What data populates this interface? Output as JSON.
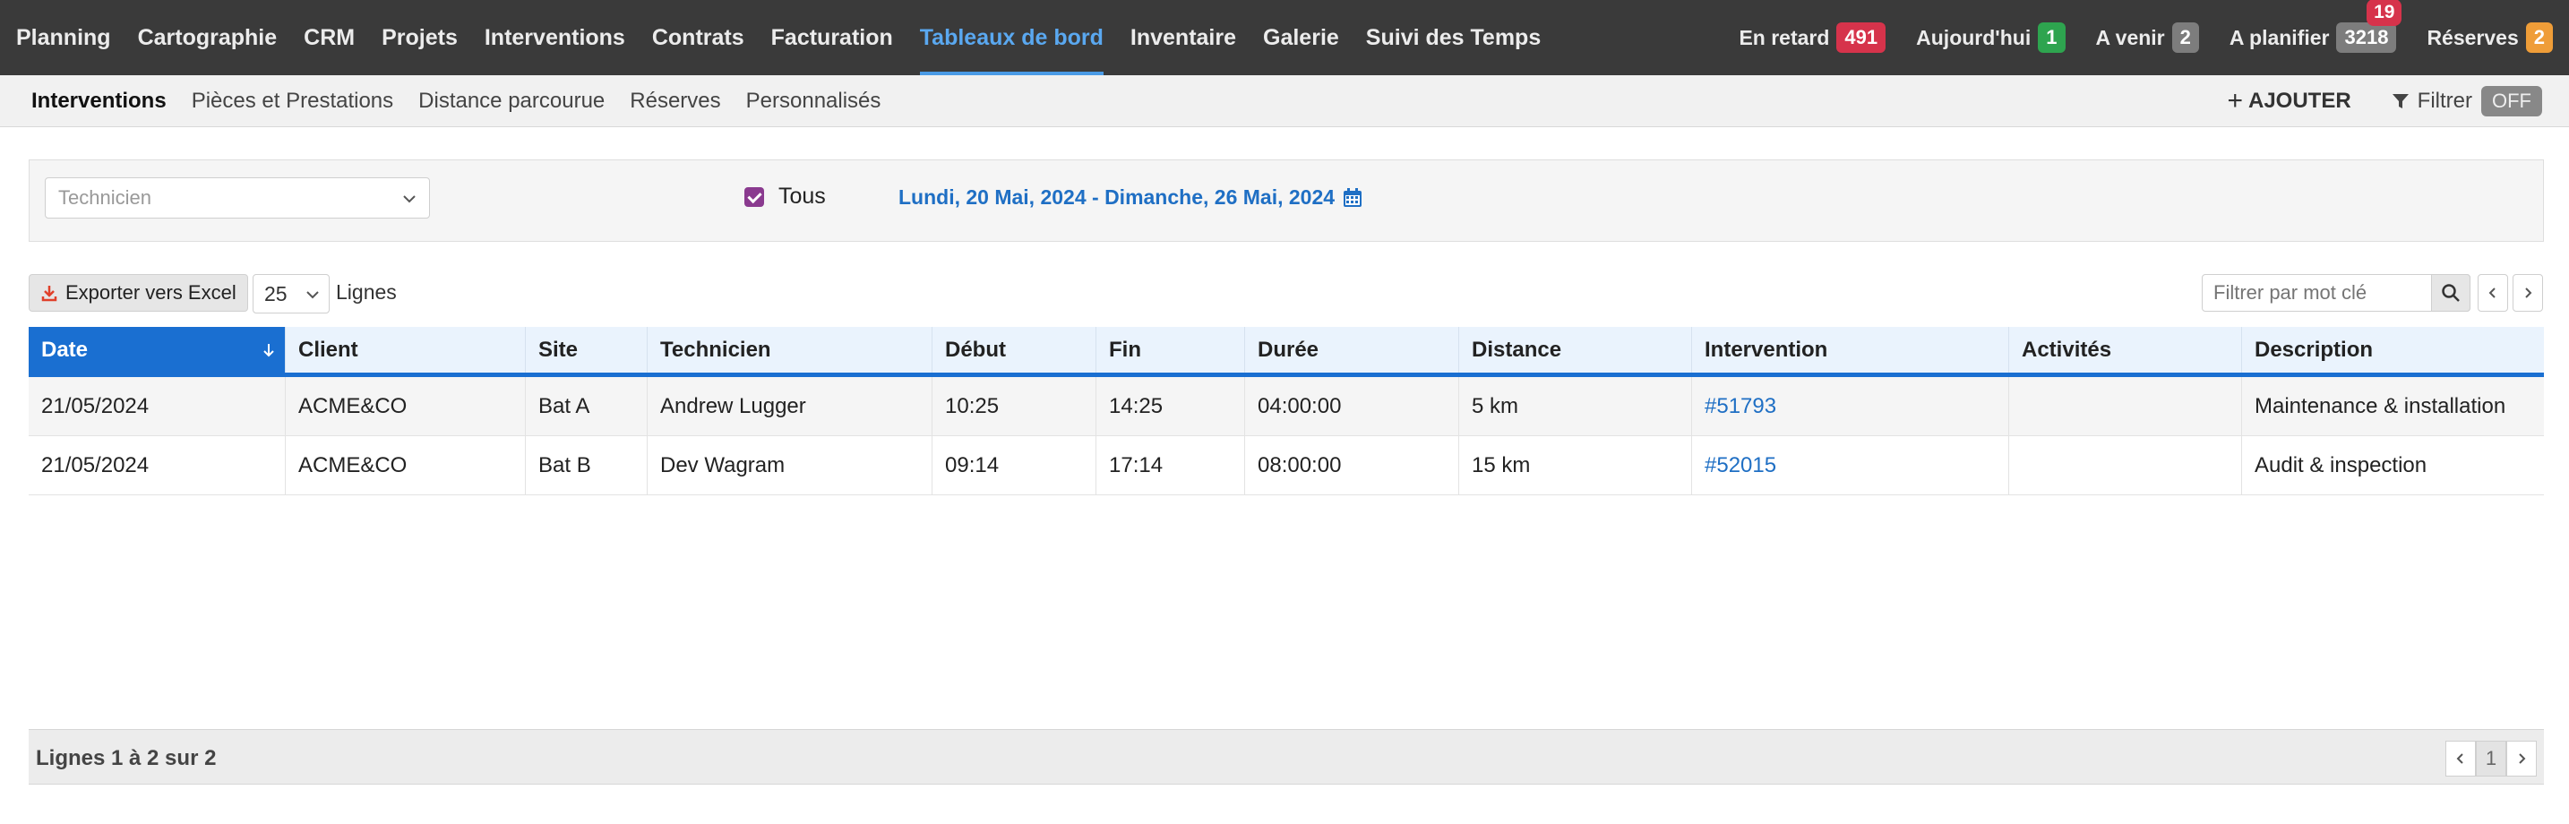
{
  "topnav": {
    "menu": [
      "Planning",
      "Cartographie",
      "CRM",
      "Projets",
      "Interventions",
      "Contrats",
      "Facturation",
      "Tableaux de bord",
      "Inventaire",
      "Galerie",
      "Suivi des Temps"
    ],
    "active_index": 7,
    "counters": [
      {
        "label": "En retard",
        "value": "491",
        "color": "red"
      },
      {
        "label": "Aujourd'hui",
        "value": "1",
        "color": "green"
      },
      {
        "label": "A venir",
        "value": "2",
        "color": "gray"
      },
      {
        "label": "A planifier",
        "value": "3218",
        "color": "gray",
        "extra": "19"
      },
      {
        "label": "Réserves",
        "value": "2",
        "color": "orange"
      }
    ]
  },
  "subnav": {
    "tabs": [
      "Interventions",
      "Pièces et Prestations",
      "Distance parcourue",
      "Réserves",
      "Personnalisés"
    ],
    "active_index": 0,
    "add_label": "AJOUTER",
    "filter_label": "Filtrer",
    "filter_state": "OFF"
  },
  "filters": {
    "technician_placeholder": "Technicien",
    "all_label": "Tous",
    "date_range": "Lundi, 20 Mai, 2024 - Dimanche, 26 Mai, 2024"
  },
  "controls": {
    "export_label": "Exporter vers Excel",
    "rows_value": "25",
    "rows_label": "Lignes",
    "search_placeholder": "Filtrer par mot clé"
  },
  "table": {
    "columns": [
      "Date",
      "Client",
      "Site",
      "Technicien",
      "Début",
      "Fin",
      "Durée",
      "Distance",
      "Intervention",
      "Activités",
      "Description"
    ],
    "rows": [
      [
        "21/05/2024",
        "ACME&CO",
        "Bat A",
        "Andrew Lugger",
        "10:25",
        "14:25",
        "04:00:00",
        "5 km",
        "#51793",
        "",
        "Maintenance & installation"
      ],
      [
        "21/05/2024",
        "ACME&CO",
        "Bat B",
        "Dev Wagram",
        "09:14",
        "17:14",
        "08:00:00",
        "15 km",
        "#52015",
        "",
        "Audit & inspection"
      ]
    ]
  },
  "footer": {
    "info": "Lignes 1 à 2 sur 2",
    "current_page": "1"
  },
  "colors": {
    "navbar": "#3a3a3a",
    "accent": "#1a6fd1",
    "active_menu": "#5aa8f0",
    "link": "#1f6fc4"
  }
}
